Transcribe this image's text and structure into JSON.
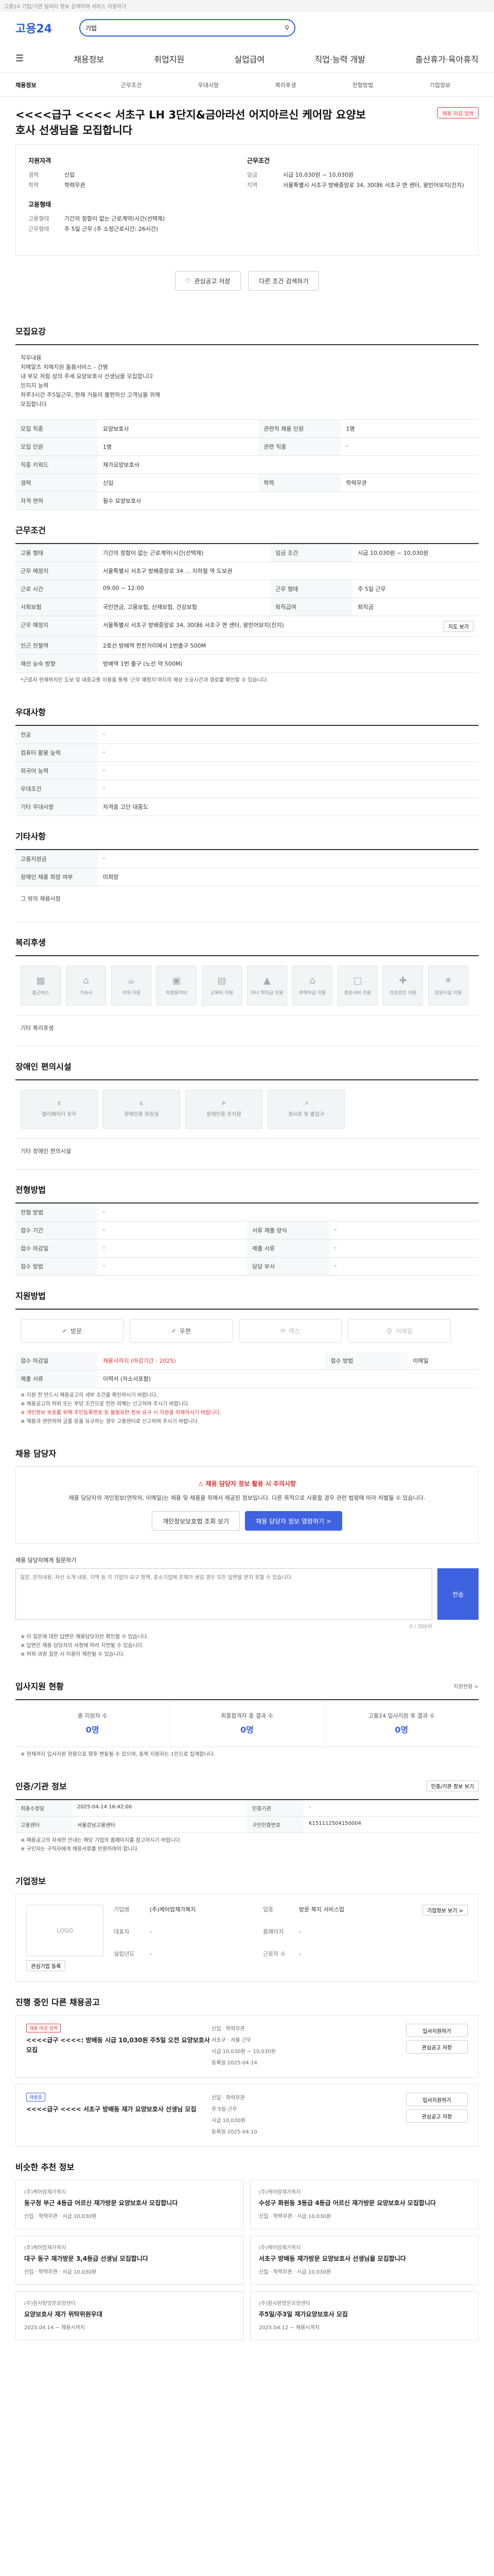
{
  "topbar": {
    "text": "고용24 기업/기관 일자리 정보 검색하여 서비스 이용하기"
  },
  "header": {
    "logo": "고용24",
    "search_placeholder": "검색",
    "search_value": "기업"
  },
  "gnb": {
    "items": [
      "채용정보",
      "취업지원",
      "실업급여",
      "직업·능력 개발",
      "출산휴가·육아휴직"
    ]
  },
  "subnav": {
    "items": [
      "채용정보",
      "근무조건",
      "우대사항",
      "복리후생",
      "전형방법",
      "기업정보"
    ]
  },
  "title": {
    "text": "<<<<급구 <<<< 서초구 LH 3단지&금아라선 어지아르신 케어맘 요양보호사 선생님을 모집합니다",
    "badge": "채용 마감 임박"
  },
  "summary": {
    "left1": {
      "heading": "지원자격",
      "rows": [
        {
          "k": "경력",
          "v": "신입"
        },
        {
          "k": "학력",
          "v": "학력무관"
        }
      ]
    },
    "right1": {
      "heading": "근무조건",
      "rows": [
        {
          "k": "임금",
          "v": "시급 10,030원 ~ 10,030원"
        },
        {
          "k": "지역",
          "v": "서울특별시 서초구 방배중앙로 34, 30대6 서초구 면 센터, 왕빈어보지(진지)"
        }
      ]
    },
    "left2": {
      "heading": "고용형태",
      "rows": [
        {
          "k": "고용형태",
          "v": "기간의 정함이 없는 근로계약(시간(선택제)"
        },
        {
          "k": "근무형태",
          "v": "주 5일 근무 (주 소정근로시간: 26시간)"
        }
      ]
    }
  },
  "actions": {
    "save": "관심공고 저장",
    "apply": "다른 조건 검색하기"
  },
  "recruit_detail": {
    "heading": "모집요강",
    "text": "직무내용\n치매알츠 치매지원 돌봄서비스 - 간병\n내 부모 처럼 성의 주세 요양보호사 선생님을 모집합니다\n인지지 능력\n하루3시간 주5일근무, 현재 거동이 불편하신 고객님을 위해\n모집합니다",
    "rows": [
      {
        "th": "모집 직종",
        "v": "요양보호사",
        "th2": "관련직 채용 인원",
        "v2": "1명"
      },
      {
        "th": "모집 인원",
        "v": "1명",
        "th2": "관련 직종",
        "v2": "-"
      },
      {
        "th": "직종 키워드",
        "v": "재가요양보호사",
        "th2": "",
        "v2": ""
      },
      {
        "th": "경력",
        "v": "신입",
        "th2": "학력",
        "v2": "학력무관"
      },
      {
        "th": "자격 면허",
        "v": "필수 요양보호사",
        "th2": "",
        "v2": ""
      }
    ]
  },
  "work_cond": {
    "heading": "근무조건",
    "rows": [
      {
        "th": "고용 형태",
        "v": "기간의 정함이 없는 근로계약(시간(선택제)",
        "th2": "임금 조건",
        "v2": "시급 10,030원 ~ 10,030원"
      },
      {
        "th": "근무 예정지",
        "v": "서울특별시 서초구 방배중앙로 34 ... 지하철 역 도보권"
      },
      {
        "th": "근로 시간",
        "v": "09:00 ~ 12:00",
        "th2": "근무 형태",
        "v2": "주 5일 근무"
      },
      {
        "th": "사회보험",
        "v": "국민연금, 고용보험, 산재보험, 건강보험",
        "th2": "퇴직급여",
        "v2": "퇴직금"
      },
      {
        "th": "근무 예정지",
        "v": "서울특별시 서초구 방배중앙로 34, 30대6 서초구 면 센터, 왕빈어보지(진지)",
        "btn": "지도 보기"
      },
      {
        "th": "인근 전철역",
        "v": "2호선 방배역 한전거리에서 1번출구 500M"
      },
      {
        "th": "채선 능숙 방향",
        "v": "방배역 1번 출구 (노선 약 500M)"
      }
    ],
    "note": "*근로자 현재위치인 도보 및 대중교통 이용을 통해 '근무 예정지'까지의 예상 소요시간과 경로를 확인할 수 있습니다."
  },
  "preference": {
    "heading": "우대사항",
    "rows": [
      {
        "th": "전공",
        "v": "-"
      },
      {
        "th": "컴퓨터 활용 능력",
        "v": "-"
      },
      {
        "th": "외국어 능력",
        "v": "-"
      },
      {
        "th": "우대조건",
        "v": "-"
      },
      {
        "th": "기타 우대사항",
        "v": "자격증 고단 대중도"
      }
    ]
  },
  "other": {
    "heading": "기타사항",
    "rows": [
      {
        "th": "고용지원금",
        "v": "-"
      },
      {
        "th": "장애인 채용 희망 여부",
        "v": "미희망"
      }
    ],
    "extra_label": "그 밖의 채용사항"
  },
  "welfare": {
    "heading": "복리후생",
    "items": [
      "통근버스",
      "기숙사",
      "식대 지원",
      "차량유지비",
      "교육비 지원",
      "자녀 학자금 지원",
      "주택자금 지원",
      "경조사비 지원",
      "건강검진 지원",
      "휴양시설 지원"
    ],
    "other_label": "기타 복리후생"
  },
  "disabled": {
    "heading": "장애인 편의시설",
    "items": [
      "엘리베이터 유무",
      "장애인용 화장실",
      "장애인용 주차장",
      "경사로 및 출입구"
    ],
    "other_label": "기타 장애인 편의시설"
  },
  "screening": {
    "heading": "전형방법",
    "rows": [
      {
        "th": "전형 방법",
        "v": "-"
      },
      {
        "th": "접수 기간",
        "v": "-",
        "th2": "서류 제출 양식",
        "v2": "-"
      },
      {
        "th": "접수 마감일",
        "v": "-",
        "th2": "제출 서류",
        "v2": "-"
      },
      {
        "th": "접수 방법",
        "v": "-",
        "th2": "담당 부서",
        "v2": "-"
      }
    ]
  },
  "apply": {
    "heading": "지원방법",
    "methods": [
      "방문",
      "우편",
      "팩스",
      "이메일"
    ],
    "period_label": "접수 마감일",
    "period_value": "채용시까지 (마감기간 : 2025)",
    "contact_label": "접수 방법",
    "contact_value": "이메일",
    "mail_label": "제출 서류",
    "mail_value": "이력서 (자소서포함)",
    "bullets": [
      "※ 지원 전 반드시 채용공고의 세부 조건을 확인하시기 바랍니다.",
      "※ 채용공고의 허위 또는 부당 조건으로 인한 피해는 신고하여 주시기 바랍니다.",
      "※ 개인정보 보호를 위해 주민등록번호 등 불필요한 정보 요구 시 지원을 자제하시기 바랍니다.",
      "※ 채용과 관련하여 금품 등을 요구하는 경우 고용센터로 신고하여 주시기 바랍니다."
    ]
  },
  "contact": {
    "heading": "채용 담당자",
    "warn": "채용 담당자 정보 활용 시 주의사항",
    "text": "채용 담당자의 개인정보(연락처, 이메일)는 채용 및 채용을 위해서 제공된 정보입니다. 다른 목적으로 사용할 경우 관련 법령에 따라 처벌될 수 있습니다.",
    "btn1": "개인정보보호법 조회 보기",
    "btn2": "채용 담당자 정보 열람하기 >",
    "ask_label": "채용 담당자에게 질문하기",
    "ask_placeholder": "질문, 문의내용, 자신 소개 내용, 지역 등 각 기업이 요구 정책, 중소기업에 문제가 생길 경우 모든 답변을 받지 못할 수 있습니다.",
    "ask_send": "전송",
    "ask_count": "0 / 300자",
    "notes": [
      "※ 이 질문에 대한 답변은 채용담당자만 확인할 수 있습니다.",
      "※ 답변은 채용 담당자의 사정에 따라 지연될 수 있습니다.",
      "※ 허위·과장 질문 시 이용이 제한될 수 있습니다."
    ]
  },
  "apply_stats": {
    "heading": "입사지원 현황",
    "link": "지원현황 >",
    "items": [
      {
        "label": "총 지원자 수",
        "value": "0명"
      },
      {
        "label": "최종합격자 중 결과 수",
        "value": "0명"
      },
      {
        "label": "고용24 입사지원 후 결과 수",
        "value": "0명"
      }
    ],
    "note": "※ 현재까지 입사지원 현황으로 향후 변동될 수 있으며, 중복 지원자는 1인으로 집계합니다."
  },
  "manage_info": {
    "heading": "인증/기관 정보",
    "btn": "인증/기관 정보 보기",
    "cells": [
      {
        "th": "최종수정일",
        "v": "2025-04-14 16:42:00"
      },
      {
        "th": "인증기관",
        "v": "-"
      },
      {
        "th": "고용센터",
        "v": "서울강남고용센터"
      },
      {
        "th": "구인인증번호",
        "v": "K151112504150004"
      }
    ],
    "notes": [
      "※ 채용공고의 자세한 안내는 해당 기업의 홈페이지를 참고하시기 바랍니다.",
      "※ 구인자는 구직자에게 채용서류를 반환하여야 합니다."
    ]
  },
  "company": {
    "heading": "기업정보",
    "logo": "LOGO",
    "btn_fav": "관심기업 등록",
    "btn_more": "기업정보 보기 >",
    "rows": [
      {
        "k": "기업명",
        "v": "(주)케어맘재가복지"
      },
      {
        "k": "업종",
        "v": "방문 복지 서비스업"
      },
      {
        "k": "대표자",
        "v": "-"
      },
      {
        "k": "홈페이지",
        "v": "-"
      },
      {
        "k": "설립년도",
        "v": "-"
      },
      {
        "k": "근로자 수",
        "v": "-"
      }
    ]
  },
  "other_jobs": {
    "heading": "진행 중인 다른 채용공고",
    "items": [
      {
        "tag": "채용 마감 임박",
        "title": "<<<<급구 <<<<: 방배동 시급 10,030원 주5일 오전 요양보호사 모집",
        "info": [
          "신입 · 학력무관",
          "서초구 · 서울 근무",
          "시급 10,030원 ~ 10,030원"
        ],
        "date": "등록일 2025-04-14"
      },
      {
        "tag": "채용중",
        "title": "<<<<급구 <<<< 서초구 방배동 재가 요양보호사 선생님 모집",
        "info": [
          "신입 · 학력무관",
          "주 5일 근무",
          "시급 10,030원"
        ],
        "date": "등록일 2025-04-10"
      }
    ],
    "btn1": "입사지원하기",
    "btn2": "관심공고 저장"
  },
  "recommend": {
    "heading": "비슷한 추천 정보",
    "items": [
      {
        "company": "(주)케어맘재가복지",
        "title": "동구청 부근 4등급 어르신 재가방문 요양보호사 모집합니다",
        "meta": "신입 · 학력무관 · 시급 10,030원"
      },
      {
        "company": "(주)케어맘재가복지",
        "title": "수성구 화원동 3등급 4등급 어르신 재가방문 요양보호사 모집합니다",
        "meta": "신입 · 학력무관 · 시급 10,030원"
      },
      {
        "company": "(주)케어맘재가복지",
        "title": "대구 동구 재가방문 3,4등급 선생님 모집합니다",
        "meta": "신입 · 학력무관 · 시급 10,030원"
      },
      {
        "company": "(주)케어맘재가복지",
        "title": "서초구 방배동 재가방문 요양보호사 선생님을 모집합니다",
        "meta": "신입 · 학력무관 · 시급 10,030원"
      },
      {
        "company": "(주)참사랑방문요양센터",
        "title": "요양보호사 재가 위탁위원우대",
        "meta": "2025.04.14 ~ 채용시까지"
      },
      {
        "company": "(주)참사랑방문요양센터",
        "title": "주5일/주3일 재가요양보호사 모집",
        "meta": "2025.04.12 ~ 채용시까지"
      }
    ]
  }
}
